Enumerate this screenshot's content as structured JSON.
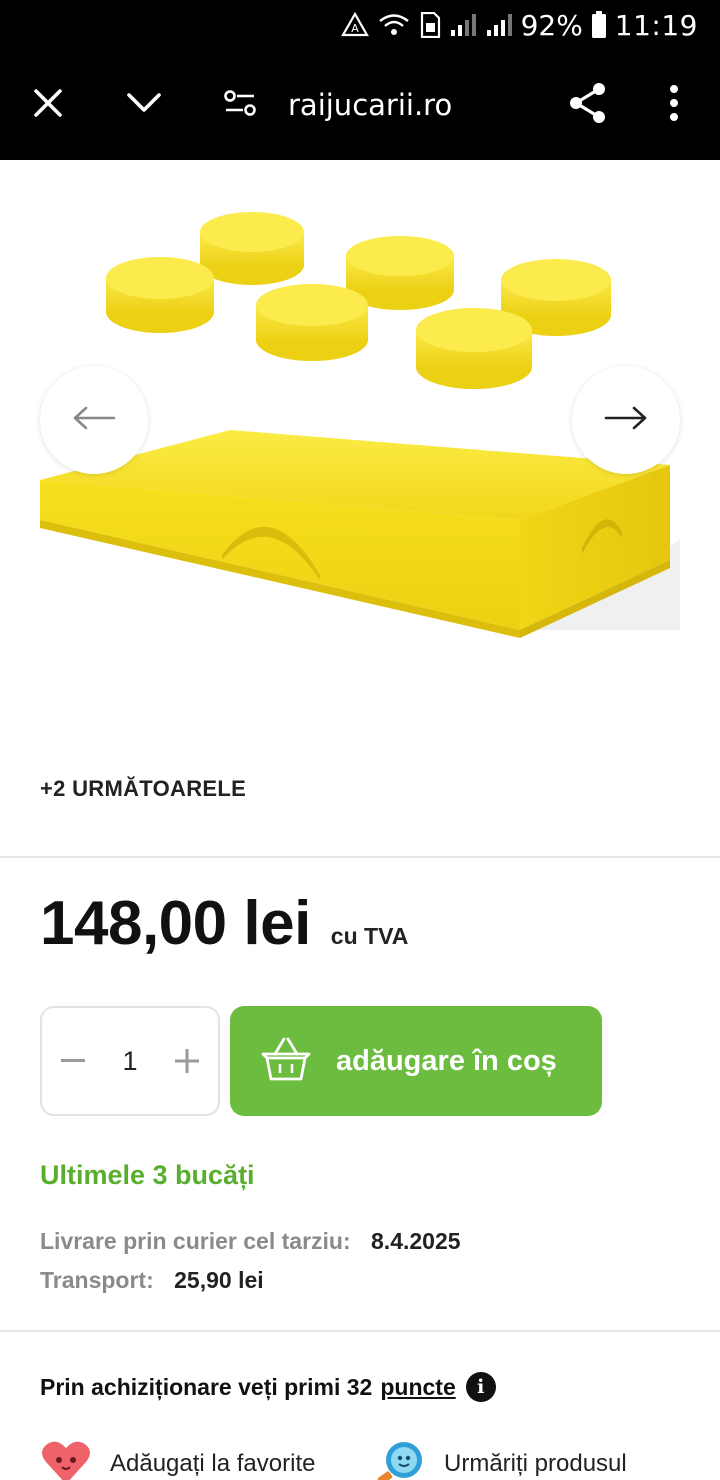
{
  "status_bar": {
    "battery_percent": "92%",
    "time": "11:19",
    "icons": [
      "recycle-alert-icon",
      "wifi-call-icon",
      "sim-icon",
      "signal-icon",
      "signal-icon",
      "battery-icon"
    ]
  },
  "browser": {
    "url": "raijucarii.ro",
    "icons": [
      "close-icon",
      "chevron-down-icon",
      "site-settings-icon",
      "share-icon",
      "more-vert-icon"
    ]
  },
  "gallery": {
    "more_images_label": "+2 URMĂTOARELE",
    "product_color": "#f7e01f"
  },
  "product": {
    "price": "148,00 lei",
    "vat_label": "cu TVA",
    "quantity": "1",
    "add_to_cart_label": "adăugare în coș",
    "stock_text": "Ultimele 3 bucăți",
    "delivery_label": "Livrare prin curier cel tarziu:",
    "delivery_date": "8.4.2025",
    "transport_label": "Transport:",
    "transport_price": "25,90 lei"
  },
  "loyalty": {
    "text": "Prin achiziționare veți primi 32",
    "link": "puncte",
    "info_glyph": "i"
  },
  "actions": {
    "favorites_label": "Adăugați la favorite",
    "watch_label": "Urmăriți produsul"
  },
  "colors": {
    "accent_green": "#6cbd3f",
    "stock_green": "#5aae2e"
  }
}
